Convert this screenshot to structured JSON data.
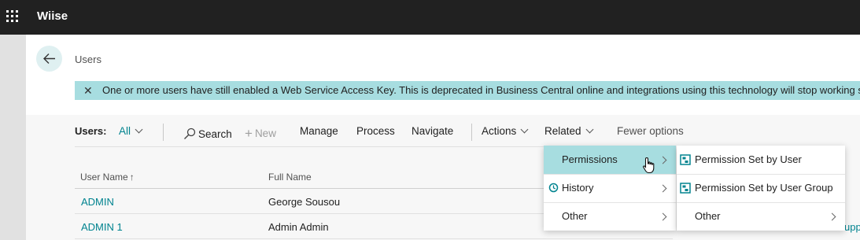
{
  "app": {
    "name": "Wiise"
  },
  "page": {
    "title": "Users"
  },
  "notice": {
    "message": "One or more users have still enabled a Web Service Access Key. This is deprecated in Business Central online and integrations using this technology will stop working so"
  },
  "commandbar": {
    "label": "Users:",
    "filter": "All",
    "search": "Search",
    "new": "New",
    "manage": "Manage",
    "process": "Process",
    "navigate": "Navigate",
    "actions": "Actions",
    "related": "Related",
    "fewer_options": "Fewer options"
  },
  "table": {
    "columns": [
      "User Name",
      "Full Name"
    ],
    "rows": [
      {
        "user_name": "ADMIN",
        "full_name": "George Sousou"
      },
      {
        "user_name": "ADMIN 1",
        "full_name": "Admin Admin"
      }
    ],
    "clipped_right_text": "upp"
  },
  "related_menu": {
    "items": [
      {
        "label": "Permissions",
        "icon": "permissions-icon",
        "highlighted": true
      },
      {
        "label": "History",
        "icon": "history-icon",
        "highlighted": false
      },
      {
        "label": "Other",
        "icon": "",
        "highlighted": false
      }
    ]
  },
  "permissions_submenu": {
    "items": [
      {
        "label": "Permission Set by User",
        "icon": "permission-set-icon"
      },
      {
        "label": "Permission Set by User Group",
        "icon": "permission-set-icon"
      },
      {
        "label": "Other",
        "icon": ""
      }
    ]
  },
  "colors": {
    "accent": "#00838f",
    "notice_bg": "#a7dde0",
    "highlight_bg": "#a7dde0",
    "topbar": "#212121"
  }
}
